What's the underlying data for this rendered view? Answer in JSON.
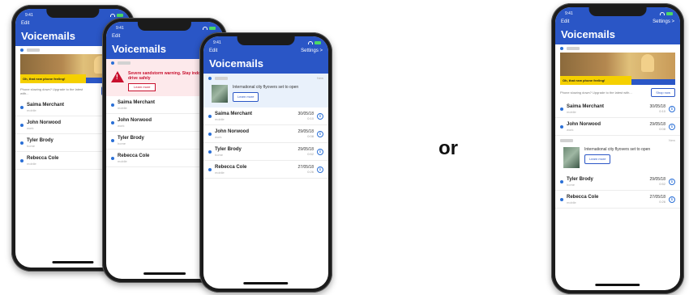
{
  "app": {
    "status_time": "9:41",
    "edit_label": "Edit",
    "settings_label": "Settings >",
    "title": "Voicemails",
    "new_label": "New"
  },
  "colors": {
    "brand_blue": "#2a56c6",
    "alert_red": "#c8102e",
    "ad_yellow": "#f5d000"
  },
  "ad": {
    "banner_text": "Oh, that new phone feeling!",
    "body": "Phone slowing down? Upgrade to the latest with...",
    "button": "Shop now"
  },
  "alert": {
    "text": "Severe sandstorm warning. Stay indoors and drive safely",
    "button": "Learn more",
    "icon": "warning-icon"
  },
  "news": {
    "text": "International city flyovers set to open",
    "button": "Learn more"
  },
  "voicemails": [
    {
      "name": "Saima Merchant",
      "type": "mobile",
      "date": "30/05/18",
      "duration": "0:10"
    },
    {
      "name": "John Norwood",
      "type": "work",
      "date": "29/05/18",
      "duration": "0:08"
    },
    {
      "name": "Tyler Brody",
      "type": "home",
      "date": "29/05/18",
      "duration": "0:52"
    },
    {
      "name": "Rebecca Cole",
      "type": "mobile",
      "date": "27/05/18",
      "duration": "0:26"
    }
  ],
  "or_label": "or"
}
